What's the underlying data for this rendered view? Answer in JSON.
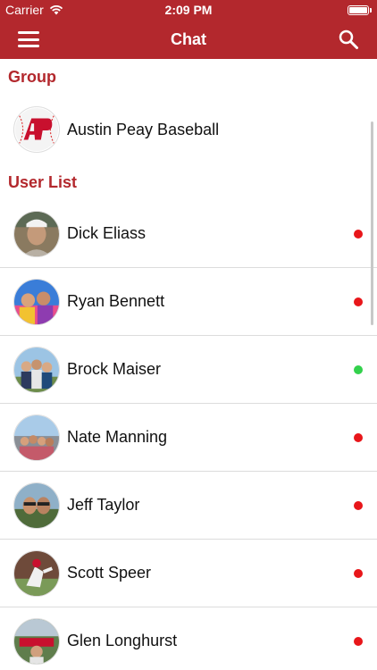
{
  "status_bar": {
    "carrier": "Carrier",
    "time": "2:09 PM"
  },
  "nav": {
    "title": "Chat"
  },
  "group_section": {
    "header": "Group",
    "items": [
      {
        "name": "Austin Peay Baseball",
        "avatar_icon": "ap-logo-icon"
      }
    ]
  },
  "user_section": {
    "header": "User List",
    "users": [
      {
        "name": "Dick Eliass",
        "status": "offline",
        "status_color": "#e8161a"
      },
      {
        "name": "Ryan Bennett",
        "status": "offline",
        "status_color": "#e8161a"
      },
      {
        "name": "Brock Maiser",
        "status": "online",
        "status_color": "#33d14c"
      },
      {
        "name": "Nate Manning",
        "status": "offline",
        "status_color": "#e8161a"
      },
      {
        "name": "Jeff Taylor",
        "status": "offline",
        "status_color": "#e8161a"
      },
      {
        "name": "Scott Speer",
        "status": "offline",
        "status_color": "#e8161a"
      },
      {
        "name": "Glen Longhurst",
        "status": "offline",
        "status_color": "#e8161a"
      }
    ]
  },
  "colors": {
    "brand": "#b3282d",
    "online": "#33d14c",
    "offline": "#e8161a"
  }
}
